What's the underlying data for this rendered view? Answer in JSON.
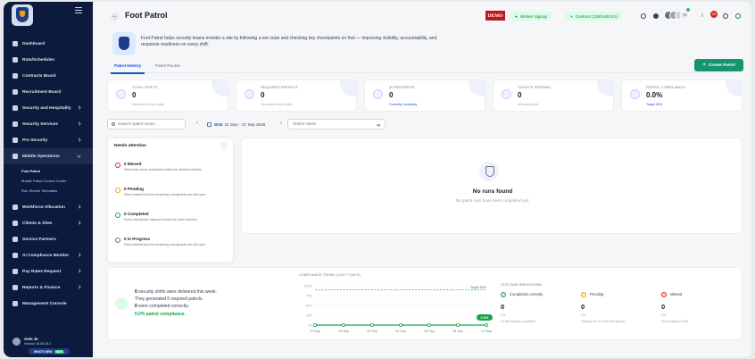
{
  "sidebar": {
    "items": [
      {
        "label": "Dashboard",
        "chevron": false
      },
      {
        "label": "Rota/Schedules",
        "chevron": false
      },
      {
        "label": "Contracts Board",
        "chevron": false
      },
      {
        "label": "Recruitment Board",
        "chevron": false
      },
      {
        "label": "Security and Hospitality",
        "chevron": true
      },
      {
        "label": "Security Services",
        "chevron": true
      },
      {
        "label": "Pro Security",
        "chevron": true
      },
      {
        "label": "Mobile Operations",
        "chevron": true
      }
    ],
    "sub_items": [
      "Foot Patrol",
      "Mobile Patrol Control Center",
      "Run Sheets Templates"
    ],
    "items_after": [
      {
        "label": "Workforce Allocation",
        "chevron": true
      },
      {
        "label": "Clients & Sites",
        "chevron": true
      },
      {
        "label": "Service Partners",
        "chevron": false
      },
      {
        "label": "AI Compliance Monitor",
        "chevron": true
      },
      {
        "label": "Pay Rates Request",
        "chevron": true
      },
      {
        "label": "Reports & Finance",
        "chevron": true
      },
      {
        "label": "Management Console",
        "chevron": false
      }
    ],
    "user": {
      "name": "Aren Jo",
      "version": "Version 16.09.26.1",
      "whats_new": "WHAT'S NEW",
      "badge": "NEW"
    }
  },
  "header": {
    "title": "Foot Patrol",
    "demo": "DEMO",
    "worker_signup": "Worker Signup",
    "contract": "Contract (139/140/141)",
    "avatar_count": "+5",
    "notif_count": "99"
  },
  "intro": {
    "description": "Foot Patrol helps security teams monitor a site by following a set route and checking key checkpoints on foot — improving visibility, accountability, and response readiness on every shift."
  },
  "tabs": [
    "Patrol History",
    "Patrol Routes"
  ],
  "create_button": "Create Patrol",
  "stats": [
    {
      "label": "Total Shifts",
      "value": "0",
      "sub": "Delivered in this range",
      "sub_color": "gray"
    },
    {
      "label": "Required Patrols",
      "value": "0",
      "sub": "Generated from shifts",
      "sub_color": "gray"
    },
    {
      "label": "In Progress",
      "value": "0",
      "sub": "Currently underway",
      "sub_color": "blue"
    },
    {
      "label": "Today's Pending",
      "value": "0",
      "sub": "Not started yet",
      "sub_color": "gray"
    },
    {
      "label": "Patrol Compliance",
      "value": "0.0%",
      "sub": "Target 90%",
      "sub_color": "blue"
    }
  ],
  "filters": {
    "search_placeholder": "Search patrol route...",
    "week_code": "W19",
    "week_range": "21 Sep – 27 Sep 2026",
    "client_placeholder": "Select client"
  },
  "attention": {
    "title": "Needs attention",
    "items": [
      {
        "title": "0 Missed",
        "desc": "Patrol was never completed within the allowed window",
        "color": "#dc2626"
      },
      {
        "title": "0 Pending",
        "desc": "Patrol started but the remaining checkpoints are still open",
        "color": "#f59e0b"
      },
      {
        "title": "0 Completed",
        "desc": "Every checkpoint captured inside the patrol window",
        "color": "#16a34a"
      },
      {
        "title": "0 In Progress",
        "desc": "Patrol started but the remaining checkpoints are still open",
        "color": "#6b7280"
      }
    ]
  },
  "runs": {
    "title": "No runs found",
    "message": "No patrol runs have been completed yet."
  },
  "summary": {
    "line1_pre": "0",
    "line1_post": " security shifts were delivered this week.",
    "line2": "They generated 0 required patrols.",
    "line3_pre": "0",
    "line3_post": " were completed correctly.",
    "line4": "0.0% patrol compliance."
  },
  "chart_data": {
    "type": "line",
    "title": "COMPLIANCE TREND (LAST 7 DAYS)",
    "categories": [
      "21 Sep",
      "22 Sep",
      "23 Sep",
      "24 Sep",
      "25 Sep",
      "26 Sep",
      "27 Sep"
    ],
    "series": [
      {
        "name": "",
        "values": [
          0,
          0,
          0,
          0,
          0,
          0,
          0
        ]
      }
    ],
    "yticks": [
      "100%",
      "75%",
      "50%",
      "25%",
      "0%"
    ],
    "ylim": [
      0,
      100
    ],
    "target": 90,
    "target_label": "Target 90%",
    "last_label": "0.0%",
    "color": "#16a34a"
  },
  "breakdown": {
    "title": "OUTCOME BREAKDOWN",
    "items": [
      {
        "label": "Completed correctly",
        "value": "0",
        "pct": "0%",
        "note": "All checkpoints completed",
        "color": "#16a34a"
      },
      {
        "label": "Pending",
        "value": "0",
        "pct": "0%",
        "note": "Missing one or more checkpoints",
        "color": "#f59e0b"
      },
      {
        "label": "Missed",
        "value": "0",
        "pct": "0%",
        "note": "Not completed at all",
        "color": "#dc2626"
      }
    ]
  }
}
